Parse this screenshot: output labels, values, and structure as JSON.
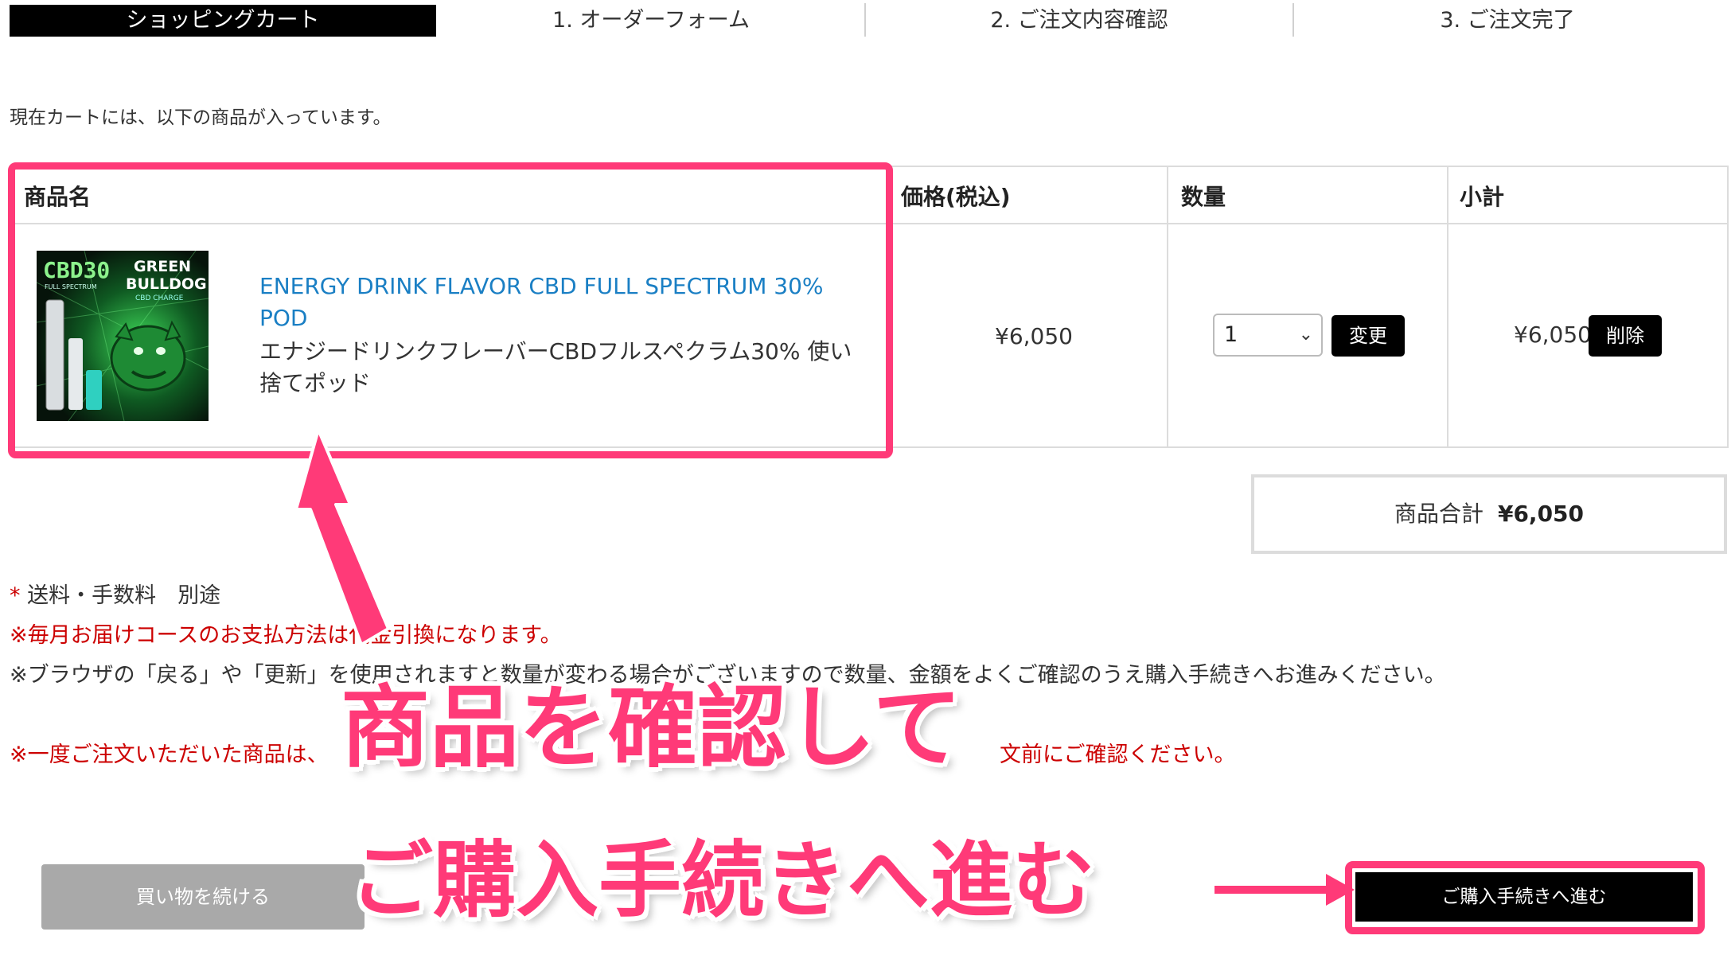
{
  "steps": [
    {
      "label": "ショッピングカート",
      "active": true
    },
    {
      "label": "1. オーダーフォーム"
    },
    {
      "label": "2. ご注文内容確認"
    },
    {
      "label": "3. ご注文完了"
    }
  ],
  "intro": "現在カートには、以下の商品が入っています。",
  "table": {
    "headers": {
      "product": "商品名",
      "price": "価格(税込)",
      "quantity": "数量",
      "subtotal": "小計"
    },
    "row": {
      "image_text": {
        "line1": "CBD30",
        "line2": "GREEN",
        "line3": "BULLDOG",
        "line4": "FULL SPECTRUM",
        "line5": "CBD CHARGE"
      },
      "name_en": "ENERGY DRINK FLAVOR CBD FULL SPECTRUM 30% POD",
      "name_ja": "エナジードリンクフレーバーCBDフルスペクラム30% 使い捨てポッド",
      "price": "¥6,050",
      "quantity": "1",
      "change_label": "変更",
      "subtotal": "¥6,050",
      "delete_label": "削除"
    }
  },
  "total": {
    "label": "商品合計",
    "value": "¥6,050"
  },
  "notes": {
    "shipping_star": "*",
    "shipping": " 送料・手数料　別途",
    "monthly": "※毎月お届けコースのお支払方法は代金引換になります。",
    "browser": "※ブラウザの「戻る」や「更新」を使用されますと数量が変わる場合がございますので数量、金額をよくご確認のうえ購入手続きへお進みください。",
    "once_left": "※一度ご注文いただいた商品は、",
    "once_right": "文前にご確認ください。"
  },
  "buttons": {
    "continue": "買い物を続ける",
    "proceed": "ご購入手続きへ進む"
  },
  "annotations": {
    "callout1": "商品を確認して",
    "callout2": "ご購入手続きへ進む",
    "accent": "#ff3a78"
  }
}
